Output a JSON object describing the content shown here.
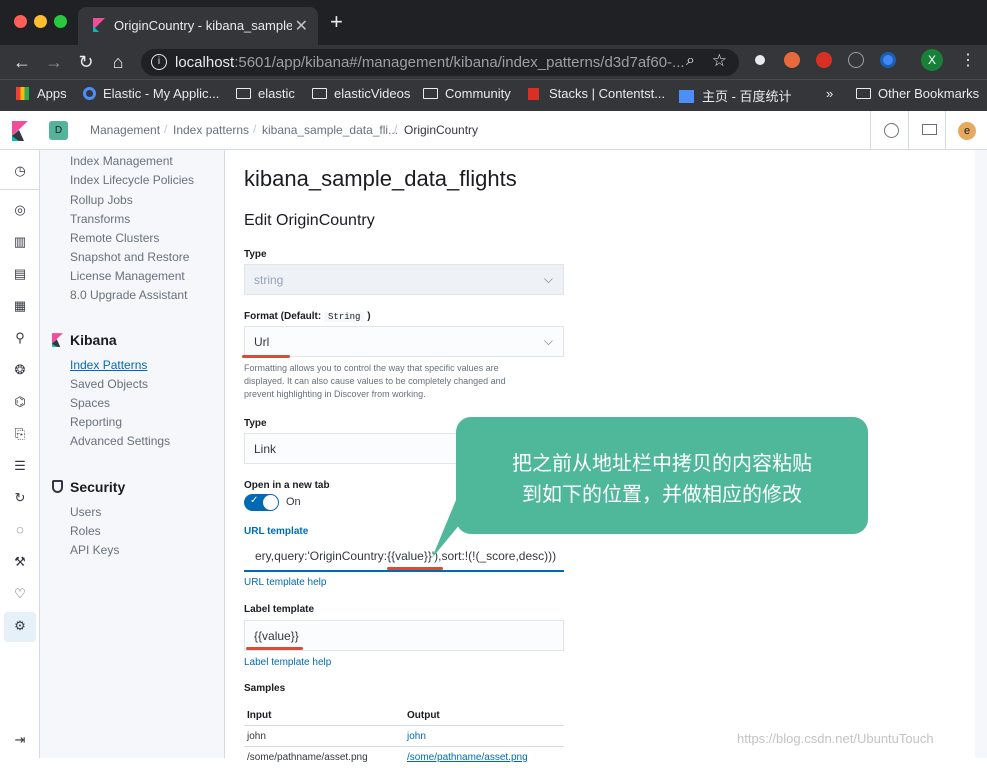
{
  "browser": {
    "tab_title": "OriginCountry - kibana_sample_d",
    "tab_close": "✕",
    "new_tab": "+",
    "url_host": "localhost",
    "url_rest": ":5601/app/kibana#/management/kibana/index_patterns/d3d7af60-...",
    "avatar_letter": "X",
    "bookmarks": [
      "Apps",
      "Elastic - My Applic...",
      "elastic",
      "elasticVideos",
      "Community",
      "Stacks | Contentst...",
      "主页 - 百度统计",
      "»",
      "Other Bookmarks"
    ]
  },
  "kibana_header": {
    "space_badge": "D",
    "breadcrumbs": [
      "Management",
      "Index patterns",
      "kibana_sample_data_fli...",
      "OriginCountry"
    ],
    "user_avatar": "e"
  },
  "sidenav": {
    "elasticsearch_items": [
      "Index Management",
      "Index Lifecycle Policies",
      "Rollup Jobs",
      "Transforms",
      "Remote Clusters",
      "Snapshot and Restore",
      "License Management",
      "8.0 Upgrade Assistant"
    ],
    "kibana_title": "Kibana",
    "kibana_items": [
      "Index Patterns",
      "Saved Objects",
      "Spaces",
      "Reporting",
      "Advanced Settings"
    ],
    "security_title": "Security",
    "security_items": [
      "Users",
      "Roles",
      "API Keys"
    ]
  },
  "main": {
    "page_title": "kibana_sample_data_flights",
    "section_title": "Edit OriginCountry",
    "type_label": "Type",
    "type_value": "string",
    "format_label": "Format (Default:",
    "format_default": "String",
    "format_close": ")",
    "format_value": "Url",
    "format_help": [
      "Formatting allows you to control the way that specific values are",
      "displayed. It can also cause values to be completely changed and",
      "prevent highlighting in Discover from working."
    ],
    "type2_label": "Type",
    "type2_value": "Link",
    "newtab_label": "Open in a new tab",
    "newtab_value": "On",
    "url_template_label": "URL template",
    "url_template_value": "ery,query:'OriginCountry:{{value}}'),sort:!(!(_score,desc)))",
    "url_template_help": "URL template help",
    "label_template_label": "Label template",
    "label_template_value": "{{value}}",
    "label_template_help": "Label template help",
    "samples_title": "Samples",
    "samples_headers": [
      "Input",
      "Output"
    ],
    "samples_rows": [
      {
        "input": "john",
        "output": "john"
      },
      {
        "input": "/some/pathname/asset.png",
        "output": "/some/pathname/asset.png"
      }
    ]
  },
  "callout": {
    "line1": "把之前从地址栏中拷贝的内容粘贴",
    "line2": "到如下的位置，并做相应的修改"
  },
  "watermark": "https://blog.csdn.net/UbuntuTouch",
  "colors": {
    "accent": "#006bb4",
    "callout": "#4fb89a",
    "toggle": "#006bb4",
    "annotation": "#d94b3a"
  }
}
